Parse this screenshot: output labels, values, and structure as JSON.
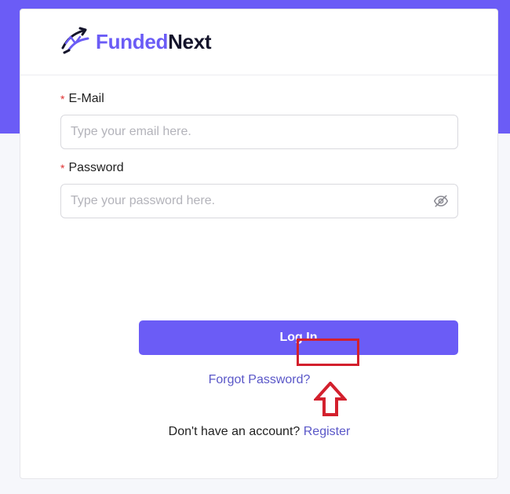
{
  "brand": {
    "name_part1": "Funded",
    "name_part2": "Next",
    "accent_color": "#6b5cf6"
  },
  "form": {
    "email": {
      "label": "E-Mail",
      "required_mark": "*",
      "placeholder": "Type your email here.",
      "value": ""
    },
    "password": {
      "label": "Password",
      "required_mark": "*",
      "placeholder": "Type your password here.",
      "value": "",
      "toggle_icon": "eye-off-icon"
    },
    "login_button": "Log In",
    "forgot_password": "Forgot Password?",
    "register_prompt": "Don't have an account?",
    "register_link": "Register"
  },
  "annotations": {
    "highlight_color": "#d3202d",
    "arrow_icon": "up-arrow-icon"
  }
}
